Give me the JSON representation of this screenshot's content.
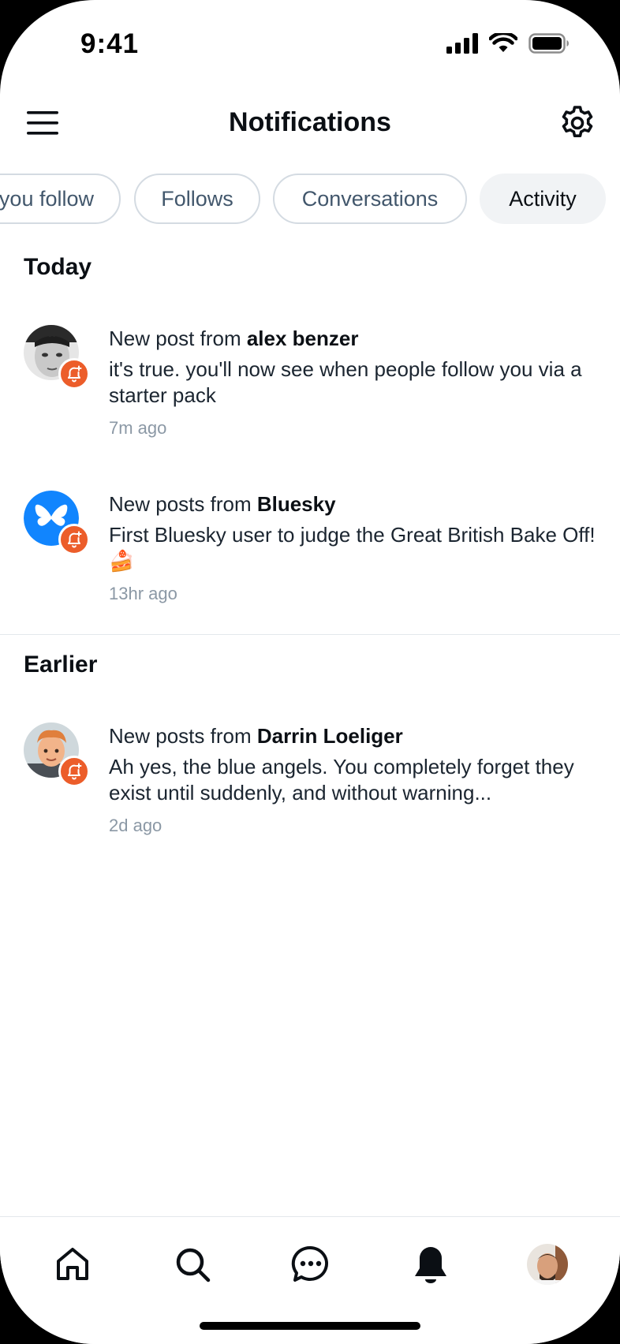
{
  "status_bar": {
    "time": "9:41"
  },
  "header": {
    "title": "Notifications"
  },
  "tabs": [
    {
      "label": "you follow"
    },
    {
      "label": "Follows"
    },
    {
      "label": "Conversations"
    },
    {
      "label": "Activity",
      "active": true
    }
  ],
  "sections": [
    {
      "title": "Today",
      "items": [
        {
          "prefix": "New post from ",
          "author": "alex benzer",
          "text": "it's true. you'll now see when people follow you via a starter pack",
          "ago": "7m ago"
        },
        {
          "prefix": "New posts from ",
          "author": "Bluesky",
          "text": "First Bluesky user to judge the Great British Bake Off! 🍰",
          "ago": "13hr ago"
        }
      ]
    },
    {
      "title": "Earlier",
      "items": [
        {
          "prefix": "New posts from ",
          "author": "Darrin Loeliger",
          "text": "Ah yes, the blue angels. You completely forget they exist until suddenly, and without warning...",
          "ago": "2d ago"
        }
      ]
    }
  ],
  "bottom_nav": [
    {
      "icon": "home-icon"
    },
    {
      "icon": "search-icon"
    },
    {
      "icon": "chat-icon"
    },
    {
      "icon": "bell-icon",
      "active": true
    },
    {
      "icon": "profile-avatar"
    }
  ],
  "colors": {
    "accent_badge": "#ec5d2a",
    "bluesky_blue": "#1185fe",
    "active_tab_bg": "#f1f3f5",
    "muted_text": "#8b98a5"
  }
}
